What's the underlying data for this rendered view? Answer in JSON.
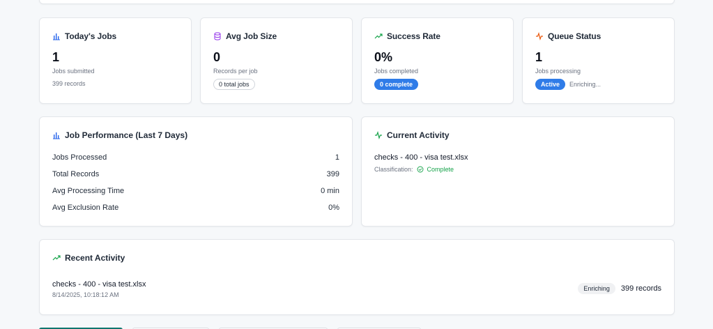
{
  "stats": [
    {
      "title": "Today's Jobs",
      "icon": "bar-chart-icon",
      "value": "1",
      "subtitle": "Jobs submitted",
      "extra": "399 records"
    },
    {
      "title": "Avg Job Size",
      "icon": "database-icon",
      "value": "0",
      "subtitle": "Records per job",
      "badge": "0 total jobs"
    },
    {
      "title": "Success Rate",
      "icon": "trending-up-icon",
      "value": "0%",
      "subtitle": "Jobs completed",
      "badge": "0 complete"
    },
    {
      "title": "Queue Status",
      "icon": "activity-icon",
      "value": "1",
      "subtitle": "Jobs processing",
      "badge": "Active",
      "status_text": "Enriching..."
    }
  ],
  "performance": {
    "title": "Job Performance (Last 7 Days)",
    "metrics": [
      {
        "label": "Jobs Processed",
        "value": "1"
      },
      {
        "label": "Total Records",
        "value": "399"
      },
      {
        "label": "Avg Processing Time",
        "value": "0 min"
      },
      {
        "label": "Avg Exclusion Rate",
        "value": "0%"
      }
    ]
  },
  "current_activity": {
    "title": "Current Activity",
    "file": "checks - 400 - visa test.xlsx",
    "classification_label": "Classification:",
    "classification_status": "Complete"
  },
  "recent_activity": {
    "title": "Recent Activity",
    "items": [
      {
        "file": "checks - 400 - visa test.xlsx",
        "timestamp": "8/14/2025, 10:18:12 AM",
        "status": "Enriching",
        "records": "399 records"
      }
    ]
  },
  "colors": {
    "accent_blue": "#2f7ce8",
    "success_green": "#16a34a",
    "warn_orange": "#ea580c",
    "purple": "#9333ea",
    "icon_blue": "#2563eb",
    "tab_active": "#0f766e"
  }
}
